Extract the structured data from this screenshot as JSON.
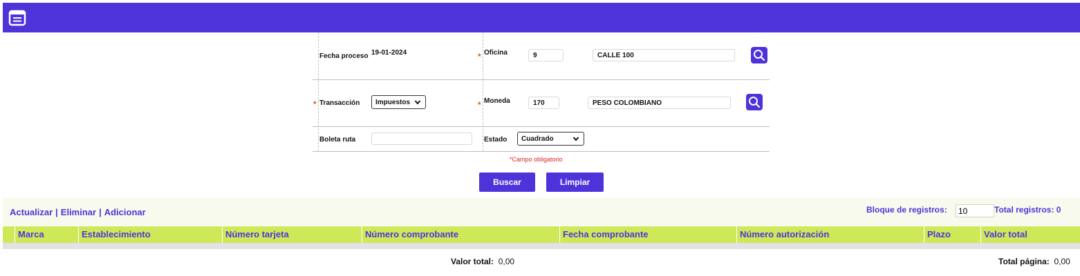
{
  "header": {
    "menu_icon": "list-card-icon",
    "color": "#4e33db"
  },
  "form": {
    "fecha_proceso": {
      "label": "Fecha proceso",
      "value": "19-01-2024"
    },
    "oficina": {
      "label": "Oficina",
      "code": "9",
      "name": "CALLE 100",
      "required_mark": "*"
    },
    "transaccion": {
      "label": "Transacción",
      "selected": "Impuestos",
      "required_mark": "*"
    },
    "moneda": {
      "label": "Moneda",
      "code": "170",
      "name": "PESO COLOMBIANO",
      "required_mark": "*"
    },
    "boleta_ruta": {
      "label": "Boleta ruta",
      "value": ""
    },
    "estado": {
      "label": "Estado",
      "selected": "Cuadrado"
    },
    "required_note": "*Campo obligatorio"
  },
  "buttons": {
    "buscar": "Buscar",
    "limpiar": "Limpiar"
  },
  "toolbar": {
    "actualizar": "Actualizar",
    "eliminar": "Eliminar",
    "adicionar": "Adicionar",
    "separator": "|",
    "bloque_label": "Bloque de registros:",
    "bloque_value": "10",
    "total_registros": "Total registros: 0"
  },
  "table": {
    "columns": [
      "Marca",
      "Establecimiento",
      "Número tarjeta",
      "Número comprobante",
      "Fecha comprobante",
      "Número autorización",
      "Plazo",
      "Valor total"
    ],
    "header_color": "#cde958",
    "rows": []
  },
  "footer": {
    "valor_total_label": "Valor total:",
    "valor_total_value": "0,00",
    "total_pagina_label": "Total página:",
    "total_pagina_value": "0,00"
  }
}
